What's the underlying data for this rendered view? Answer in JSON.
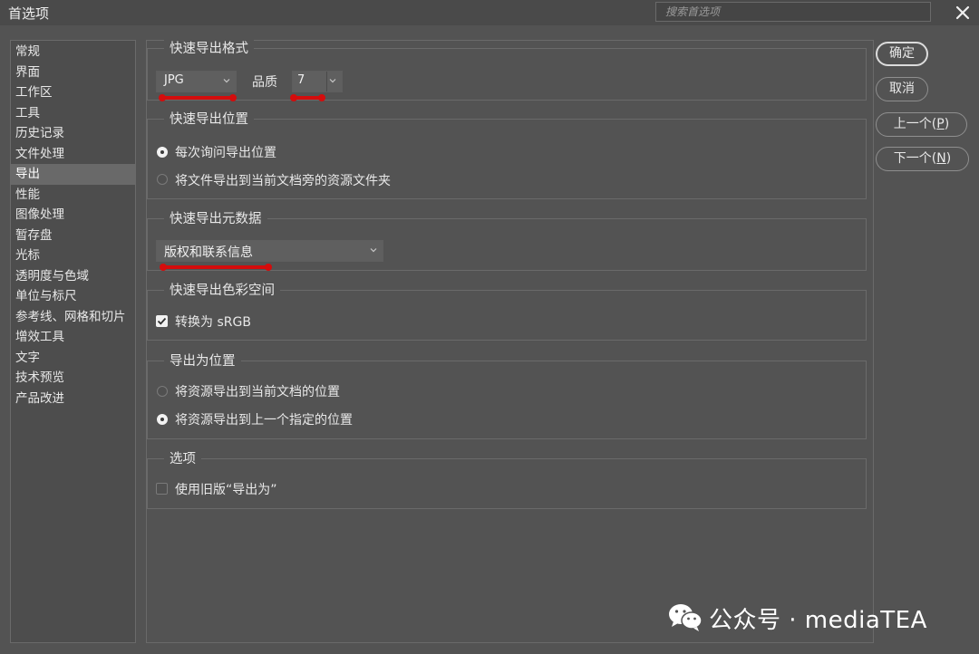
{
  "window": {
    "title": "首选项",
    "search_placeholder": "搜索首选项"
  },
  "sidebar": {
    "selected": "导出",
    "items": [
      "常规",
      "界面",
      "工作区",
      "工具",
      "历史记录",
      "文件处理",
      "导出",
      "性能",
      "图像处理",
      "暂存盘",
      "光标",
      "透明度与色域",
      "单位与标尺",
      "参考线、网格和切片",
      "增效工具",
      "文字",
      "技术预览",
      "产品改进"
    ]
  },
  "quick_format": {
    "legend": "快速导出格式",
    "format_value": "JPG",
    "quality_label": "品质",
    "quality_value": "7"
  },
  "quick_location": {
    "legend": "快速导出位置",
    "options": [
      "每次询问导出位置",
      "将文件导出到当前文档旁的资源文件夹"
    ],
    "selected_index": 0
  },
  "quick_metadata": {
    "legend": "快速导出元数据",
    "value": "版权和联系信息"
  },
  "quick_color": {
    "legend": "快速导出色彩空间",
    "checkbox_label": "转换为 sRGB",
    "checked": true
  },
  "export_as_location": {
    "legend": "导出为位置",
    "options": [
      "将资源导出到当前文档的位置",
      "将资源导出到上一个指定的位置"
    ],
    "selected_index": 1
  },
  "options": {
    "legend": "选项",
    "checkbox_label": "使用旧版“导出为”",
    "checked": false
  },
  "buttons": {
    "ok": "确定",
    "cancel": "取消",
    "prev_label": "上一个(",
    "prev_key": "P",
    "prev_close": ")",
    "next_label": "下一个(",
    "next_key": "N",
    "next_close": ")"
  },
  "watermark": {
    "text": "公众号 · mediaTEA"
  },
  "colors": {
    "background": "#535353",
    "selection": "#696969",
    "annotation_red": "#d40c0c"
  }
}
